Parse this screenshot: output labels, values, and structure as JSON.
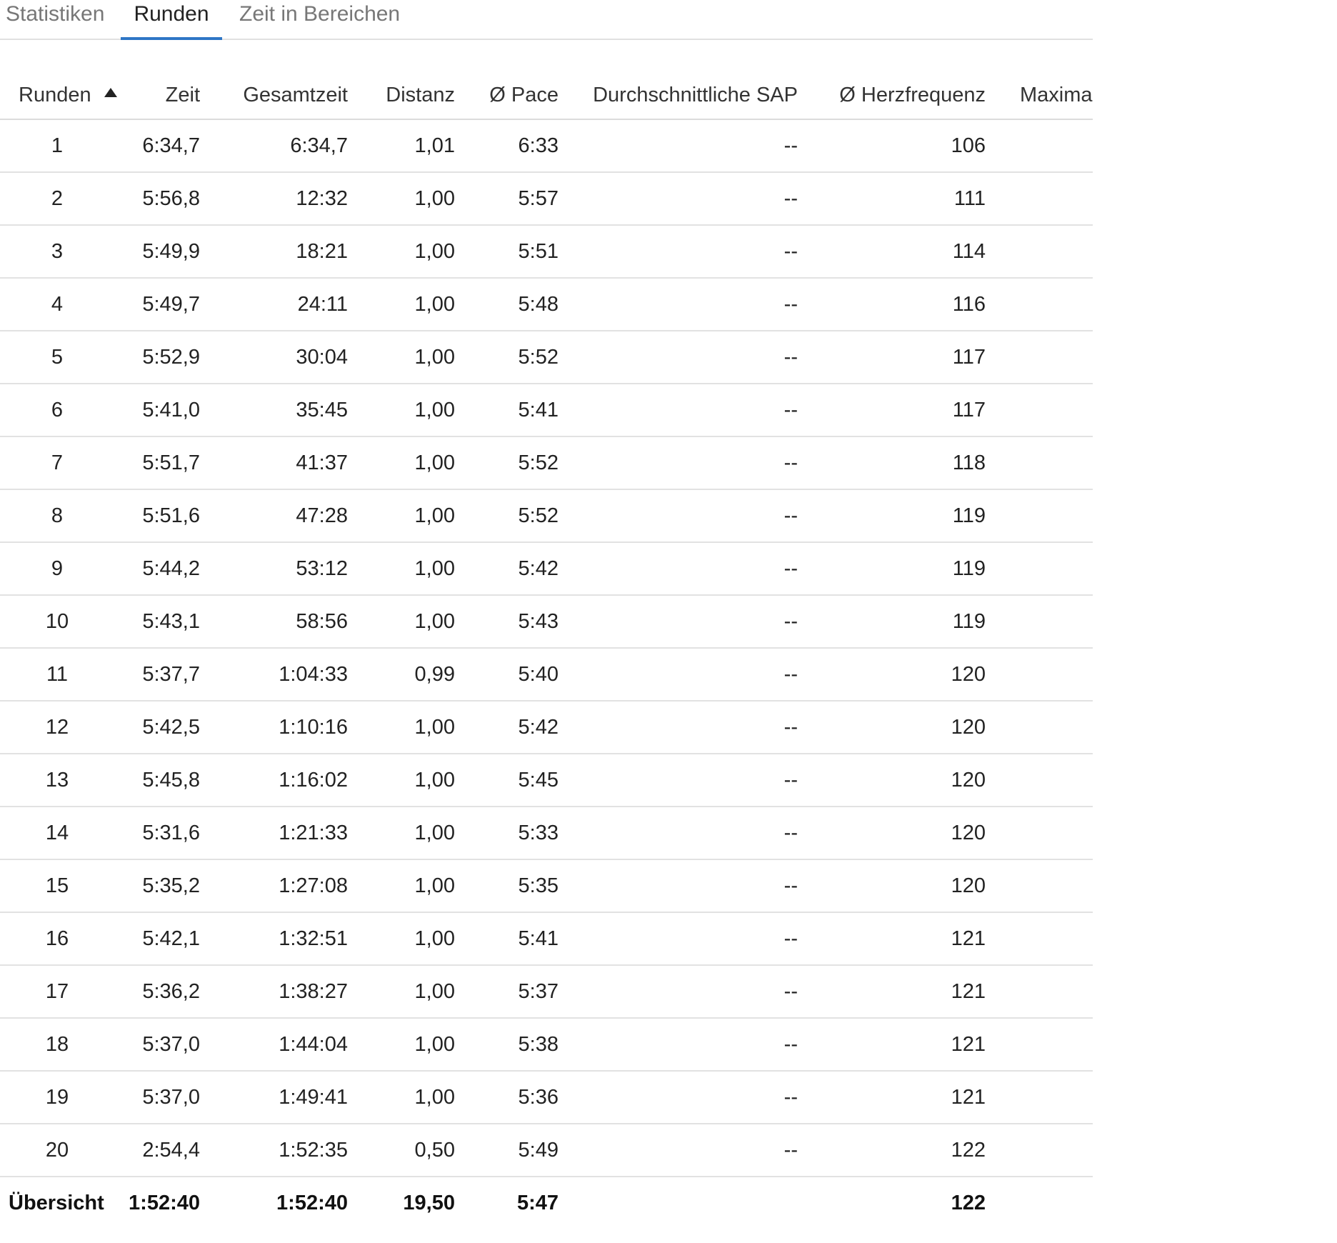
{
  "tabs": [
    {
      "label": "Statistiken",
      "active": false
    },
    {
      "label": "Runden",
      "active": true
    },
    {
      "label": "Zeit in Bereichen",
      "active": false
    }
  ],
  "colors": {
    "accent": "#2e76c6",
    "divider": "#e2e2e2",
    "inactive_tab": "#777777"
  },
  "icons": {
    "sort": "sort-ascending-icon"
  },
  "table": {
    "columns": [
      "Runden",
      "Zeit",
      "Gesamtzeit",
      "Distanz",
      "Ø Pace",
      "Durchschnittliche SAP",
      "Ø Herzfrequenz",
      "Maximal"
    ],
    "sorted_column": "Runden",
    "sort_direction": "ascending",
    "rows": [
      [
        "1",
        "6:34,7",
        "6:34,7",
        "1,01",
        "6:33",
        "--",
        "106",
        ""
      ],
      [
        "2",
        "5:56,8",
        "12:32",
        "1,00",
        "5:57",
        "--",
        "111",
        ""
      ],
      [
        "3",
        "5:49,9",
        "18:21",
        "1,00",
        "5:51",
        "--",
        "114",
        ""
      ],
      [
        "4",
        "5:49,7",
        "24:11",
        "1,00",
        "5:48",
        "--",
        "116",
        ""
      ],
      [
        "5",
        "5:52,9",
        "30:04",
        "1,00",
        "5:52",
        "--",
        "117",
        ""
      ],
      [
        "6",
        "5:41,0",
        "35:45",
        "1,00",
        "5:41",
        "--",
        "117",
        ""
      ],
      [
        "7",
        "5:51,7",
        "41:37",
        "1,00",
        "5:52",
        "--",
        "118",
        ""
      ],
      [
        "8",
        "5:51,6",
        "47:28",
        "1,00",
        "5:52",
        "--",
        "119",
        ""
      ],
      [
        "9",
        "5:44,2",
        "53:12",
        "1,00",
        "5:42",
        "--",
        "119",
        ""
      ],
      [
        "10",
        "5:43,1",
        "58:56",
        "1,00",
        "5:43",
        "--",
        "119",
        ""
      ],
      [
        "11",
        "5:37,7",
        "1:04:33",
        "0,99",
        "5:40",
        "--",
        "120",
        ""
      ],
      [
        "12",
        "5:42,5",
        "1:10:16",
        "1,00",
        "5:42",
        "--",
        "120",
        ""
      ],
      [
        "13",
        "5:45,8",
        "1:16:02",
        "1,00",
        "5:45",
        "--",
        "120",
        ""
      ],
      [
        "14",
        "5:31,6",
        "1:21:33",
        "1,00",
        "5:33",
        "--",
        "120",
        ""
      ],
      [
        "15",
        "5:35,2",
        "1:27:08",
        "1,00",
        "5:35",
        "--",
        "120",
        ""
      ],
      [
        "16",
        "5:42,1",
        "1:32:51",
        "1,00",
        "5:41",
        "--",
        "121",
        ""
      ],
      [
        "17",
        "5:36,2",
        "1:38:27",
        "1,00",
        "5:37",
        "--",
        "121",
        ""
      ],
      [
        "18",
        "5:37,0",
        "1:44:04",
        "1,00",
        "5:38",
        "--",
        "121",
        ""
      ],
      [
        "19",
        "5:37,0",
        "1:49:41",
        "1,00",
        "5:36",
        "--",
        "121",
        ""
      ],
      [
        "20",
        "2:54,4",
        "1:52:35",
        "0,50",
        "5:49",
        "--",
        "122",
        ""
      ]
    ],
    "summary": [
      "Übersicht",
      "1:52:40",
      "1:52:40",
      "19,50",
      "5:47",
      "",
      "122",
      ""
    ]
  }
}
